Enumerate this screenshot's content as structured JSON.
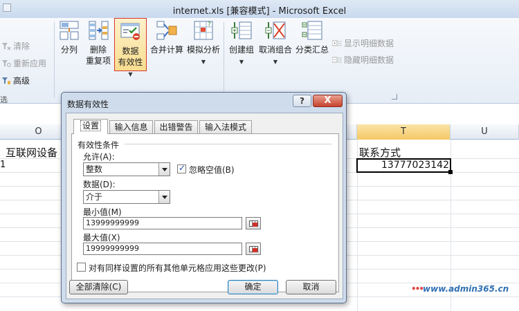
{
  "window": {
    "title": "internet.xls  [兼容模式]  -  Microsoft Excel"
  },
  "ribbon": {
    "sort_filter": {
      "clear": "清除",
      "reapply": "重新应用",
      "advanced": "高级",
      "group_label_fragment": "选"
    },
    "data_tools": {
      "split": "分列",
      "remove_dup_line1": "删除",
      "remove_dup_line2": "重复项",
      "validation_line1": "数据",
      "validation_line2": "有效性",
      "consolidate": "合并计算",
      "whatif": "模拟分析"
    },
    "outline": {
      "group": "创建组",
      "ungroup": "取消组合",
      "subtotal": "分类汇总",
      "show_detail": "显示明细数据",
      "hide_detail": "隐藏明细数据"
    }
  },
  "sheet": {
    "columns": [
      "O",
      "T",
      "U"
    ],
    "selected_column": "T",
    "cells": {
      "o1": "互联网设备",
      "t1": "联系方式",
      "t2": "13777023142",
      "row2_fragment": "1"
    }
  },
  "dialog": {
    "title": "数据有效性",
    "help_label": "?",
    "close_label": "X",
    "tabs": [
      "设置",
      "输入信息",
      "出错警告",
      "输入法模式"
    ],
    "active_tab": "设置",
    "section_title": "有效性条件",
    "allow_label": "允许(A):",
    "allow_value": "整数",
    "ignore_blank_label": "忽略空值(B)",
    "ignore_blank_checked": true,
    "data_label": "数据(D):",
    "data_value": "介于",
    "min_label": "最小值(M)",
    "min_value": "13999999999",
    "max_label": "最大值(X)",
    "max_value": "19999999999",
    "apply_all_label": "对有同样设置的所有其他单元格应用这些更改(P)",
    "apply_all_checked": false,
    "clear_all_button": "全部清除(C)",
    "ok_button": "确定",
    "cancel_button": "取消"
  },
  "watermark": {
    "dots": "•••",
    "text": "www.admin365.cn"
  },
  "colors": {
    "accent_red": "#d9342b",
    "selected_col": "#f5c865",
    "dialog_frame": "#cfdcec"
  }
}
